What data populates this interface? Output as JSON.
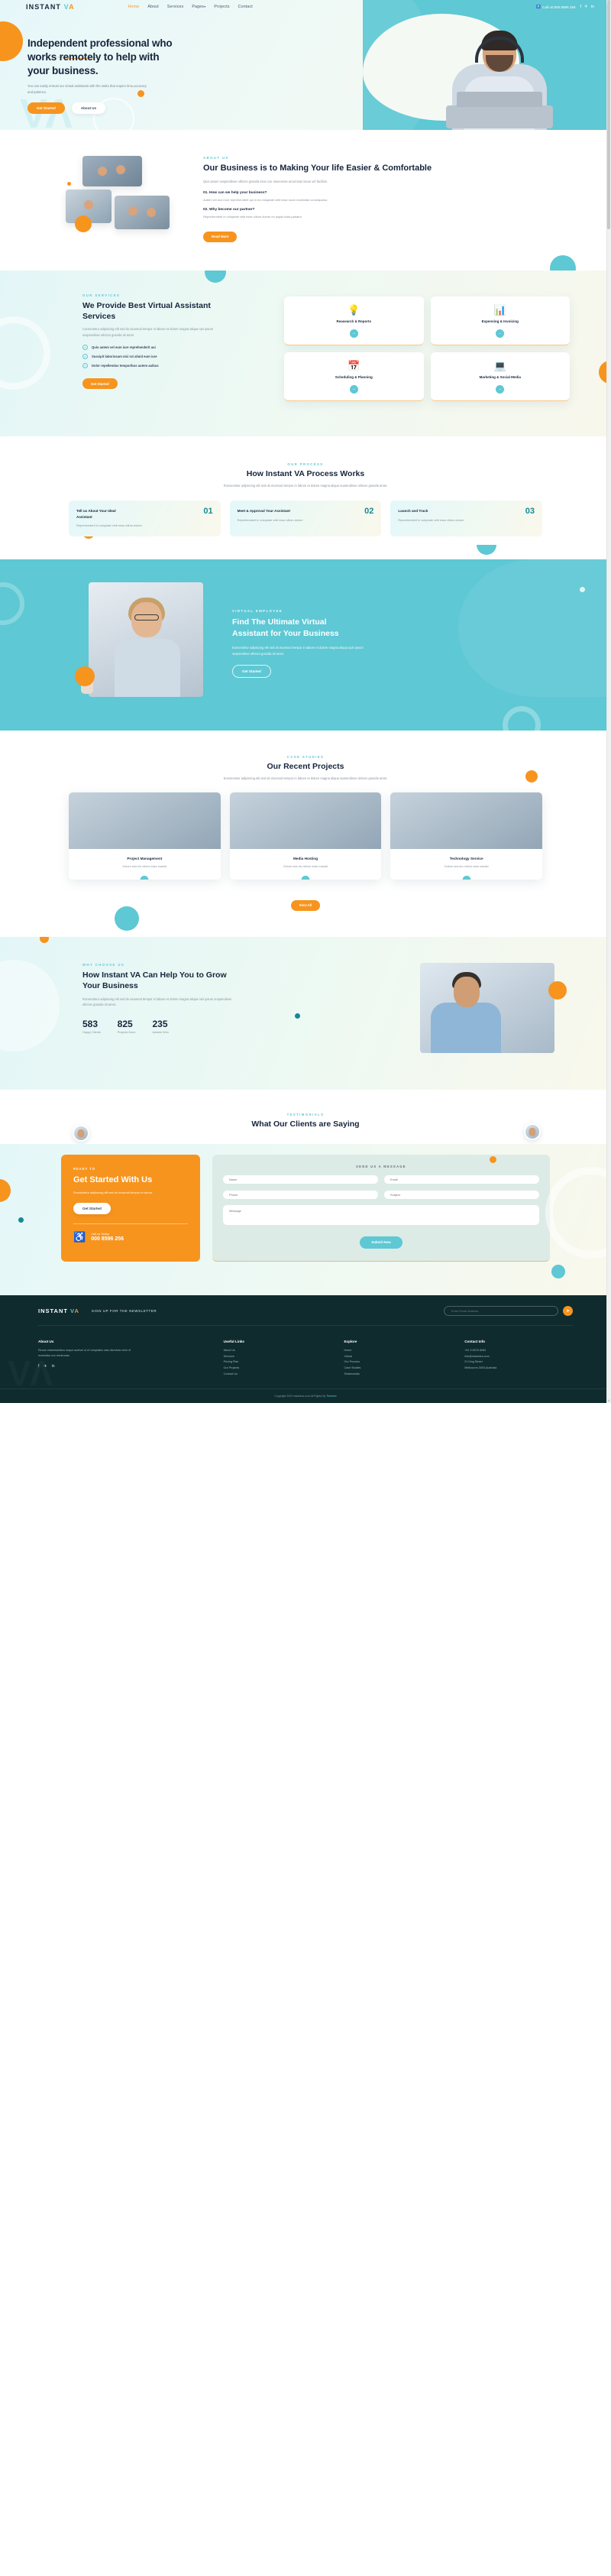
{
  "brand": {
    "name_part1": "INSTANT",
    "name_part2": "V",
    "name_part3": "A"
  },
  "header": {
    "nav": [
      {
        "label": "Home",
        "active": true
      },
      {
        "label": "About",
        "active": false
      },
      {
        "label": "Services",
        "active": false
      },
      {
        "label": "Pages",
        "active": false,
        "caret": "▾"
      },
      {
        "label": "Projects",
        "active": false
      },
      {
        "label": "Contact",
        "active": false
      }
    ],
    "call_icon": "headset-icon",
    "call_text": "Call us:000 8596 256",
    "socials": [
      "f",
      "✈",
      "in"
    ]
  },
  "hero": {
    "title": "Independent professional who works remotely to help with your business.",
    "description": "You can easily entrust our virtual assistants with the tasks that require time,accuracy and patience.",
    "btn_primary": "Get Started",
    "btn_secondary": "About Us"
  },
  "about": {
    "eyebrow": "ABOUT US",
    "title": "Our Business is to Making Your life Easier & Comfortable",
    "lead": "Quis ipsum suspendisse ultrices gravida risus coe maecenas accumsan lacus vel facilisis.",
    "qa": [
      {
        "q": "01. How can we help your business?",
        "a": "Autem vel eum iure reprehenderit qui in ea voluptate velit esse ruam molestiae consequatur."
      },
      {
        "q": "02. Why become our partner?",
        "a": "Reprehenderit in voluptate velit esse cillum dolore eu fugiat nulla pariatur."
      }
    ],
    "btn": "Read More"
  },
  "services": {
    "eyebrow": "OUR SERVICES",
    "title": "We Provide Best Virtual Assistant Services",
    "description": "Consectetur adipiscing elit sed do eiusmod tempor in labore et dolore magna aliqua ruis ipsum suspendisse ultrices gravida sit amet.",
    "bullets": [
      "Quis autem vel eum iure reprehenderit aui",
      "Suscipit laboriosam nisi rut aliuid eum iure",
      "Dolor repellendus temporibus autem auibus"
    ],
    "btn": "Get Started",
    "cards": [
      {
        "icon": "lightbulb-chart-icon",
        "title": "Reasearch & Reports",
        "arrow": "→"
      },
      {
        "icon": "invoice-chart-icon",
        "title": "Expensing & Invoicing",
        "arrow": "→"
      },
      {
        "icon": "calendar-clock-icon",
        "title": "Scheduling & Planning",
        "arrow": "→"
      },
      {
        "icon": "laptop-rocket-icon",
        "title": "Marketing & Social Media",
        "arrow": "→"
      }
    ]
  },
  "process": {
    "eyebrow": "OUR PROCESS",
    "title": "How Instant VA Process Works",
    "subtitle": "Ronsectetur adipiscing elit sed do eiusmod tempor in labore et dolore magna aliqua suarendisse ultrices gravida amet.",
    "steps": [
      {
        "num": "01",
        "title": "Tell us About Your Ideal Assistant",
        "text": "Reprehenderit in voluptate velit esse cillum dolore"
      },
      {
        "num": "02",
        "title": "Meet & Approval Your Assistant",
        "text": "Reprehenderit in voluptate velit esse cillum dolore"
      },
      {
        "num": "03",
        "title": "Launch and Track",
        "text": "Reprehenderit in voluptate velit esse cillum dolore"
      }
    ]
  },
  "virtual_employee": {
    "eyebrow": "VIRTUAL EMPLOYEE",
    "title": "Find The Ultimate Virtual Assistant for Your Business",
    "description": "Eonsectetur adipiscing elit sed do eiusmod tempor in labore et dolore magna aliqua quis ipsum suspendisse ultrices gravida sit amet.",
    "btn": "Get Started"
  },
  "projects": {
    "eyebrow": "CASE STUDIES",
    "title": "Our Recent Projects",
    "subtitle": "Eonsectetur adipiscing elit sed do eiusmod tempor in labore et dolore magna aliqua suarendisse ultrices gravida amet.",
    "cards": [
      {
        "title": "Project Management",
        "text": "Dolore sea eiu rebvm esse mautid",
        "arrow": "→"
      },
      {
        "title": "Media Hosting",
        "text": "Dolore sea eiu rebvm esse mautid",
        "arrow": "→"
      },
      {
        "title": "Technology Service",
        "text": "Dolore sea eiu rebvm esse mautid",
        "arrow": "→"
      }
    ],
    "btn": "View All"
  },
  "why": {
    "eyebrow": "WHY CHOOSE US",
    "title": "How Instant VA Can Help You to Grow Your Business",
    "description": "Ronsectetur adipiscing elit sed do eiusmod tempor in labore et dolore magna aliqua ruis ipsum suspendisse ultrices gravida sit amet.",
    "stats": [
      {
        "number": "583",
        "label": "Happy Clients"
      },
      {
        "number": "825",
        "label": "Projects Done"
      },
      {
        "number": "235",
        "label": "Awards Won"
      }
    ]
  },
  "testimonials": {
    "eyebrow": "TESTIMONIALS",
    "title": "What Our Clients are Saying"
  },
  "contact": {
    "cta": {
      "tag": "READY TO",
      "title": "Get Started With Us",
      "text": "Ronsectetur adipiscing elit sed do eiusmod tempor in labore.",
      "btn": "Get Started",
      "call_icon": "headset-icon",
      "call_label": "Call us Today:",
      "call_number": "000 8596 256"
    },
    "form": {
      "tag": "SEND US A MESSAGE",
      "fields": [
        {
          "name": "name-field",
          "placeholder": "Name"
        },
        {
          "name": "email-field",
          "placeholder": "Email"
        },
        {
          "name": "phone-field",
          "placeholder": "Phone"
        },
        {
          "name": "subject-field",
          "placeholder": "Subject"
        }
      ],
      "message_placeholder": "Message",
      "submit": "Submit Now"
    }
  },
  "footer": {
    "newsletter_text": "SIGN UP FOR THE NEWSLETTER",
    "newsletter_placeholder": "Enter Email Address",
    "newsletter_button_icon": "send-icon",
    "columns": [
      {
        "title": "About Us",
        "type": "text",
        "text": "Rerum reiaeeiiantbus seque auetvel ut et voluptates sias dicevbas enim et molestias non reiciendas."
      },
      {
        "title": "Useful Links",
        "type": "list",
        "items": [
          "About Us",
          "Services",
          "Pricing Plan",
          "Our Projects",
          "Contact Us"
        ]
      },
      {
        "title": "Explore",
        "type": "list",
        "items": [
          "Home",
          "Virtual",
          "Our Process",
          "Case Studies",
          "Testimonials"
        ]
      },
      {
        "title": "Contact Info",
        "type": "list",
        "items": [
          "+61 3 8376 6284",
          "info@instantva.com",
          "21 King Street",
          "Melbourne,3000,Australia"
        ]
      }
    ],
    "socials": [
      "f",
      "✈",
      "in"
    ],
    "copyright": "Copyright 2020 instantva.com All Rights By ",
    "copyright_link": "Themeix"
  }
}
